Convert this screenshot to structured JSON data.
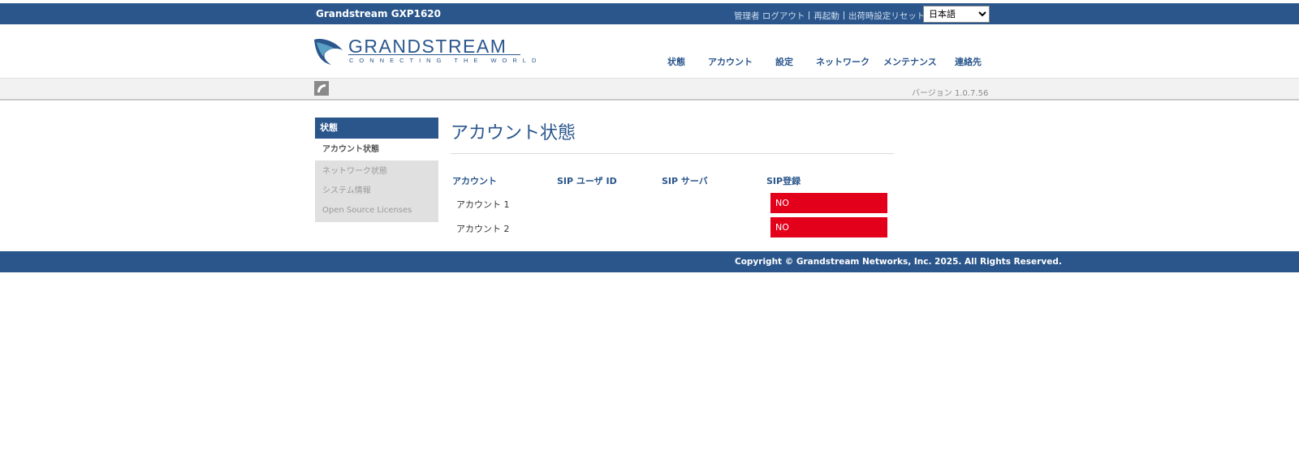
{
  "header": {
    "model": "Grandstream GXP1620",
    "links": {
      "user": "管理者",
      "logout": "ログアウト",
      "reboot": "再起動",
      "factory_reset": "出荷時設定リセット"
    },
    "language": "日本語"
  },
  "logo": {
    "brand": "GRANDSTREAM",
    "tagline": "CONNECTING THE WORLD"
  },
  "nav": {
    "status": "状態",
    "account": "アカウント",
    "settings": "設定",
    "network": "ネットワーク",
    "maintenance": "メンテナンス",
    "contacts": "連絡先"
  },
  "subbar": {
    "version": "バージョン 1.0.7.56"
  },
  "sidebar": {
    "header": "状態",
    "active": "アカウント状態",
    "items": [
      "ネットワーク状態",
      "システム情報",
      "Open Source Licenses"
    ]
  },
  "main": {
    "title": "アカウント状態",
    "table": {
      "headers": [
        "アカウント",
        "SIP ユーザ ID",
        "SIP サーバ",
        "SIP登録"
      ],
      "rows": [
        {
          "account": "アカウント 1",
          "user_id": "",
          "server": "",
          "registered": "NO"
        },
        {
          "account": "アカウント 2",
          "user_id": "",
          "server": "",
          "registered": "NO"
        }
      ]
    }
  },
  "footer": {
    "copyright": "Copyright © Grandstream Networks, Inc. 2025. All Rights Reserved."
  },
  "colors": {
    "brand_blue": "#2a568c",
    "alert_red": "#e3001b"
  }
}
